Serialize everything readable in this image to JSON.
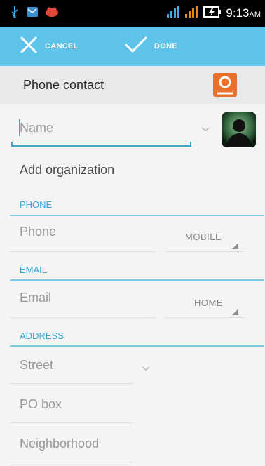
{
  "status_bar": {
    "time": "9:13",
    "ampm": "AM",
    "icons": [
      "usb-icon",
      "email-notification-icon",
      "game-notification-icon",
      "wifi-icon",
      "signal-icon",
      "battery-charging-icon"
    ]
  },
  "action_bar": {
    "cancel_label": "CANCEL",
    "done_label": "DONE"
  },
  "account": {
    "label": "Phone contact",
    "icon": "contact-account-icon",
    "accent_color": "#e8702a"
  },
  "name_field": {
    "placeholder": "Name"
  },
  "organization": {
    "label": "Add organization"
  },
  "sections": {
    "phone": {
      "title": "PHONE",
      "placeholder": "Phone",
      "type": "MOBILE"
    },
    "email": {
      "title": "EMAIL",
      "placeholder": "Email",
      "type": "HOME"
    },
    "address": {
      "title": "ADDRESS",
      "street_placeholder": "Street",
      "pobox_placeholder": "PO box",
      "neighborhood_placeholder": "Neighborhood"
    }
  },
  "colors": {
    "action_bar": "#5ec3e9",
    "section_title": "#37a8d6"
  }
}
